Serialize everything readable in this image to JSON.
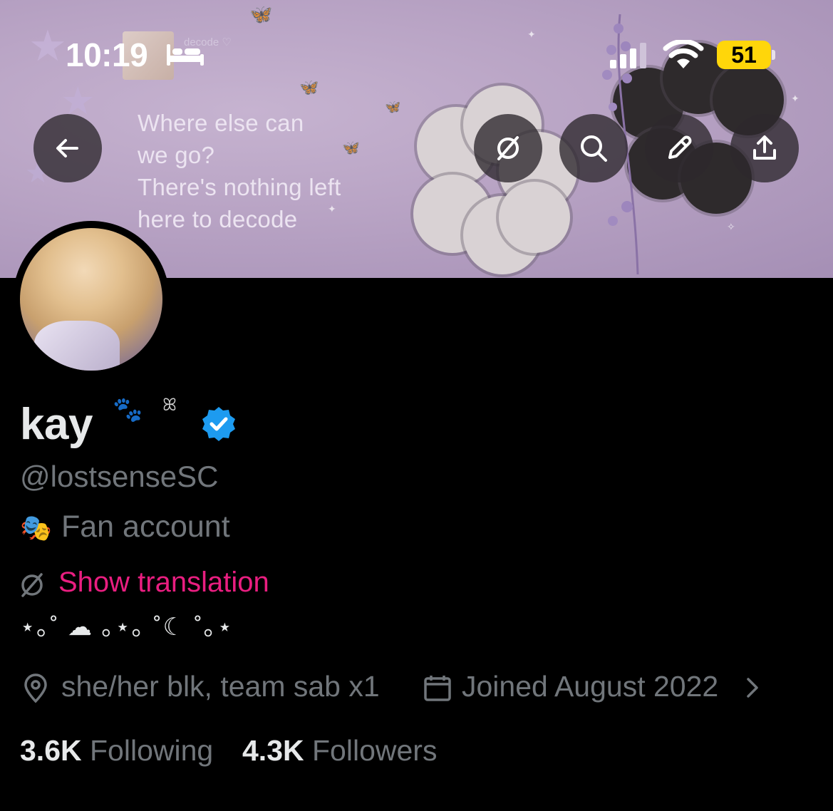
{
  "status_bar": {
    "time": "10:19",
    "battery": "51",
    "icons": [
      "bed-icon",
      "cellular-signal-icon",
      "wifi-icon",
      "battery-icon"
    ],
    "battery_color": "#ffd60a"
  },
  "banner": {
    "thumbnail_caption": "decode ♡",
    "quote_lines": [
      "Where else can",
      "we go?",
      "There's nothing left",
      "here to decode"
    ],
    "background_color": "#b8a3c4"
  },
  "header_actions": {
    "back": "arrow-left-icon",
    "translate": "translate-icon",
    "search": "search-icon",
    "edit": "pencil-icon",
    "share": "share-icon"
  },
  "profile": {
    "name": "kay",
    "name_emoji": "🐾",
    "ribbon": "ꕤ",
    "verified": true,
    "verified_color": "#1d9bf0",
    "handle": "@lostsenseSC",
    "bio_emoji": "🎭",
    "bio": "Fan account",
    "translate_label": "Show translation",
    "translate_color": "#e91e80",
    "decoration": "⋆｡˚ ☁︎ ｡⋆｡ ˚☾ ˚｡⋆",
    "location": "she/her blk, team sab x1",
    "joined": "Joined August 2022",
    "following_count": "3.6K",
    "following_label": "Following",
    "followers_count": "4.3K",
    "followers_label": "Followers"
  }
}
